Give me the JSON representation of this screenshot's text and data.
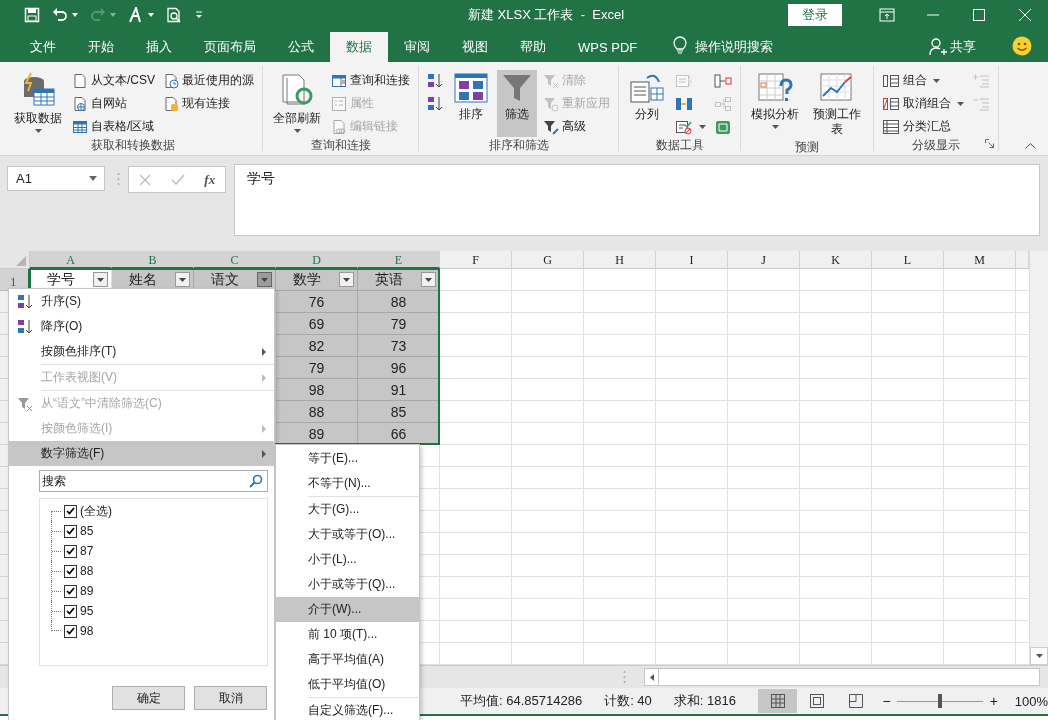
{
  "title_bar": {
    "quick_access": [
      {
        "disabled": false,
        "caret": false
      },
      {
        "disabled": false,
        "caret": true
      },
      {
        "disabled": true,
        "caret": true
      },
      {
        "disabled": false,
        "caret": true
      },
      {
        "disabled": false,
        "caret": false
      },
      {
        "disabled": false,
        "caret": false
      }
    ],
    "title": "新建 XLSX 工作表  -  Excel",
    "sign_in": "登录"
  },
  "tabs": [
    {
      "label": "文件",
      "selected": false
    },
    {
      "label": "开始",
      "selected": false
    },
    {
      "label": "插入",
      "selected": false
    },
    {
      "label": "页面布局",
      "selected": false
    },
    {
      "label": "公式",
      "selected": false
    },
    {
      "label": "数据",
      "selected": true
    },
    {
      "label": "审阅",
      "selected": false
    },
    {
      "label": "视图",
      "selected": false
    },
    {
      "label": "帮助",
      "selected": false
    },
    {
      "label": "WPS PDF",
      "selected": false
    }
  ],
  "tell_me": "操作说明搜索",
  "share": "共享",
  "ribbon": {
    "groups": [
      {
        "label": "获取和转换数据",
        "launcher": false,
        "items": [
          {
            "kind": "large",
            "label": "获取数据",
            "caret": true,
            "disabled": false,
            "pressed": false
          },
          {
            "kind": "stack",
            "buttons": [
              {
                "label": "从文本/CSV",
                "disabled": false,
                "caret": false
              },
              {
                "label": "自网站",
                "disabled": false,
                "caret": false
              },
              {
                "label": "自表格/区域",
                "disabled": false,
                "caret": false
              }
            ]
          },
          {
            "kind": "stack",
            "buttons": [
              {
                "label": "最近使用的源",
                "disabled": false,
                "caret": false
              },
              {
                "label": "现有连接",
                "disabled": false,
                "caret": false
              }
            ]
          }
        ]
      },
      {
        "label": "查询和连接",
        "launcher": false,
        "items": [
          {
            "kind": "large",
            "label": "全部刷新",
            "caret": true,
            "disabled": false,
            "pressed": false
          },
          {
            "kind": "stack",
            "buttons": [
              {
                "label": "查询和连接",
                "disabled": false,
                "caret": false
              },
              {
                "label": "属性",
                "disabled": true,
                "caret": false
              },
              {
                "label": "编辑链接",
                "disabled": true,
                "caret": false
              }
            ]
          }
        ]
      },
      {
        "label": "排序和筛选",
        "launcher": false,
        "items": [
          {
            "kind": "stack",
            "buttons": [
              {
                "disabled": false,
                "caret": false
              },
              {
                "disabled": false,
                "caret": false
              }
            ]
          },
          {
            "kind": "large",
            "label": "排序",
            "caret": false,
            "disabled": false,
            "pressed": false
          },
          {
            "kind": "large",
            "label": "筛选",
            "caret": false,
            "disabled": false,
            "pressed": true
          },
          {
            "kind": "stack",
            "buttons": [
              {
                "label": "清除",
                "disabled": true,
                "caret": false
              },
              {
                "label": "重新应用",
                "disabled": true,
                "caret": false
              },
              {
                "label": "高级",
                "disabled": false,
                "caret": false
              }
            ]
          }
        ]
      },
      {
        "label": "数据工具",
        "launcher": false,
        "items": [
          {
            "kind": "large",
            "label": "分列",
            "caret": false,
            "disabled": false,
            "pressed": false
          },
          {
            "kind": "stack",
            "buttons": [
              {
                "disabled": true,
                "caret": false
              },
              {
                "disabled": false,
                "caret": false
              },
              {
                "disabled": false,
                "caret": true
              }
            ]
          },
          {
            "kind": "stack",
            "buttons": [
              {
                "disabled": false,
                "caret": false
              },
              {
                "disabled": true,
                "caret": false
              },
              {
                "disabled": false,
                "caret": false
              }
            ]
          }
        ]
      },
      {
        "label": "预测",
        "launcher": false,
        "items": [
          {
            "kind": "large",
            "label": "模拟分析",
            "caret": true,
            "disabled": false,
            "pressed": false
          },
          {
            "kind": "large",
            "label": "预测工作表",
            "caret": false,
            "disabled": false,
            "pressed": false
          }
        ]
      },
      {
        "label": "分级显示",
        "launcher": true,
        "items": [
          {
            "kind": "stack",
            "buttons": [
              {
                "label": "组合",
                "disabled": false,
                "caret": true
              },
              {
                "label": "取消组合",
                "disabled": false,
                "caret": true
              },
              {
                "label": "分类汇总",
                "disabled": false,
                "caret": false
              }
            ]
          },
          {
            "kind": "stack",
            "buttons": [
              {
                "disabled": true,
                "caret": false
              },
              {
                "disabled": true,
                "caret": false
              }
            ]
          }
        ]
      }
    ]
  },
  "formula_bar": {
    "name_box": "A1",
    "function_label": "fx",
    "formula": "学号"
  },
  "sheet": {
    "columns": [
      {
        "letter": "A",
        "selected": true
      },
      {
        "letter": "B",
        "selected": true
      },
      {
        "letter": "C",
        "selected": true
      },
      {
        "letter": "D",
        "selected": true
      },
      {
        "letter": "E",
        "selected": true
      },
      {
        "letter": "F",
        "selected": false
      },
      {
        "letter": "G",
        "selected": false
      },
      {
        "letter": "H",
        "selected": false
      },
      {
        "letter": "I",
        "selected": false
      },
      {
        "letter": "J",
        "selected": false
      },
      {
        "letter": "K",
        "selected": false
      },
      {
        "letter": "L",
        "selected": false
      },
      {
        "letter": "M",
        "selected": false
      }
    ],
    "rows": [
      {
        "number": "1",
        "cells": [
          {
            "text": "学号",
            "filter": true,
            "filter_open": false,
            "selected": true,
            "active": true
          },
          {
            "text": "姓名",
            "filter": true,
            "filter_open": false,
            "selected": true,
            "active": false
          },
          {
            "text": "语文",
            "filter": true,
            "filter_open": true,
            "selected": true,
            "active": false
          },
          {
            "text": "数学",
            "filter": true,
            "filter_open": false,
            "selected": true,
            "active": false
          },
          {
            "text": "英语",
            "filter": true,
            "filter_open": false,
            "selected": true,
            "active": false
          }
        ]
      },
      {
        "cells": [
          {
            "text": "76",
            "selected": true,
            "active": false
          },
          {
            "text": "88",
            "selected": true,
            "active": false
          }
        ]
      },
      {
        "cells": [
          {
            "text": "69",
            "selected": true,
            "active": false
          },
          {
            "text": "79",
            "selected": true,
            "active": false
          }
        ]
      },
      {
        "cells": [
          {
            "text": "82",
            "selected": true,
            "active": false
          },
          {
            "text": "73",
            "selected": true,
            "active": false
          }
        ]
      },
      {
        "cells": [
          {
            "text": "79",
            "selected": true,
            "active": false
          },
          {
            "text": "96",
            "selected": true,
            "active": false
          }
        ]
      },
      {
        "cells": [
          {
            "text": "98",
            "selected": true,
            "active": false
          },
          {
            "text": "91",
            "selected": true,
            "active": false
          }
        ]
      },
      {
        "cells": [
          {
            "text": "88",
            "selected": true,
            "active": false
          },
          {
            "text": "85",
            "selected": true,
            "active": false
          }
        ]
      },
      {
        "cells": [
          {
            "text": "89",
            "selected": true,
            "active": false
          },
          {
            "text": "66",
            "selected": true,
            "active": false
          }
        ]
      }
    ]
  },
  "filter_menu": {
    "items": [
      {
        "kind": "sort-asc",
        "label": "升序(S)",
        "disabled": false,
        "submenu": false,
        "selected": false
      },
      {
        "kind": "sort-desc",
        "label": "降序(O)",
        "disabled": false,
        "submenu": false,
        "selected": false
      },
      {
        "kind": "plain",
        "label": "按颜色排序(T)",
        "disabled": false,
        "submenu": true,
        "selected": false
      },
      {
        "kind": "separator"
      },
      {
        "kind": "plain",
        "label": "工作表视图(V)",
        "disabled": true,
        "submenu": true,
        "selected": false
      },
      {
        "kind": "separator"
      },
      {
        "kind": "clear-filter",
        "label": "从“语文”中清除筛选(C)",
        "disabled": true,
        "submenu": false,
        "selected": false
      },
      {
        "kind": "plain",
        "label": "按颜色筛选(I)",
        "disabled": true,
        "submenu": true,
        "selected": false
      },
      {
        "kind": "plain",
        "label": "数字筛选(F)",
        "disabled": false,
        "submenu": true,
        "selected": true
      }
    ],
    "search": {
      "placeholder": "搜索"
    },
    "values": [
      {
        "label": "(全选)",
        "checked": true
      },
      {
        "label": "85",
        "checked": true
      },
      {
        "label": "87",
        "checked": true
      },
      {
        "label": "88",
        "checked": true
      },
      {
        "label": "89",
        "checked": true
      },
      {
        "label": "95",
        "checked": true
      },
      {
        "label": "98",
        "checked": true
      }
    ],
    "buttons": [
      "确定",
      "取消"
    ],
    "submenu": [
      {
        "kind": "item",
        "label": "等于(E)...",
        "selected": false
      },
      {
        "kind": "item",
        "label": "不等于(N)...",
        "selected": false
      },
      {
        "kind": "separator"
      },
      {
        "kind": "item",
        "label": "大于(G)...",
        "selected": false
      },
      {
        "kind": "item",
        "label": "大于或等于(O)...",
        "selected": false
      },
      {
        "kind": "item",
        "label": "小于(L)...",
        "selected": false
      },
      {
        "kind": "item",
        "label": "小于或等于(Q)...",
        "selected": false
      },
      {
        "kind": "item",
        "label": "介于(W)...",
        "selected": true
      },
      {
        "kind": "item",
        "label": "前 10 项(T)...",
        "selected": false
      },
      {
        "kind": "item",
        "label": "高于平均值(A)",
        "selected": false
      },
      {
        "kind": "item",
        "label": "低于平均值(O)",
        "selected": false
      },
      {
        "kind": "separator"
      },
      {
        "kind": "item",
        "label": "自定义筛选(F)...",
        "selected": false
      }
    ]
  },
  "status_bar": {
    "stats": [
      "平均值: 64.85714286",
      "计数: 40",
      "求和: 1816"
    ],
    "views": [
      {
        "selected": true
      },
      {
        "selected": false
      },
      {
        "selected": false
      }
    ],
    "zoom": {
      "minus": "−",
      "plus": "+",
      "level": 0.5,
      "percent": "100%"
    }
  }
}
